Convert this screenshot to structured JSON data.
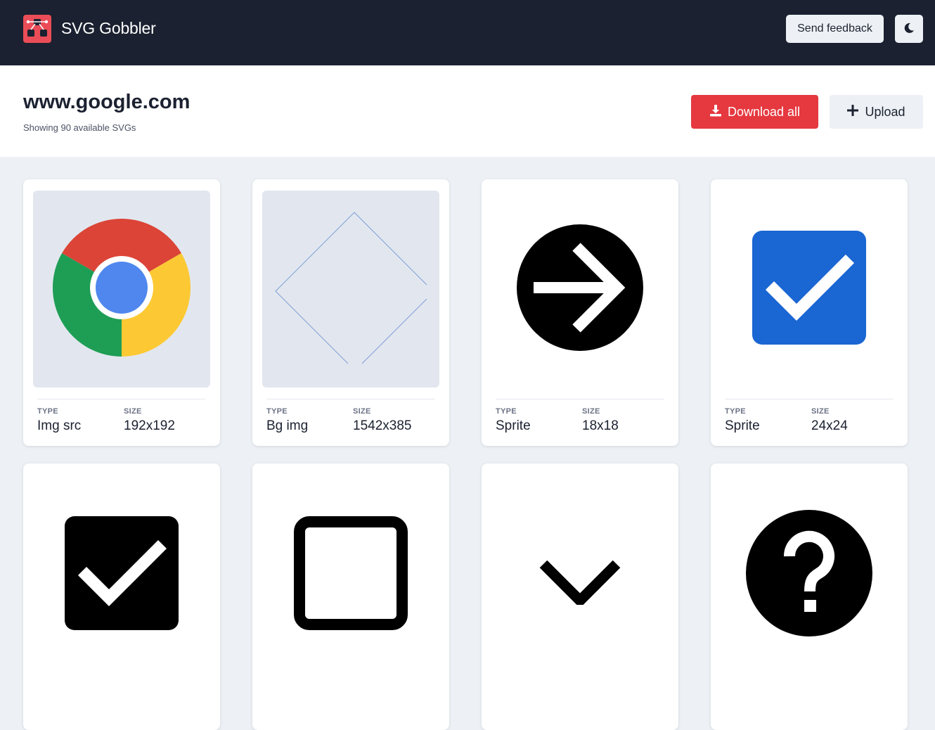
{
  "app": {
    "title": "SVG Gobbler",
    "feedback_label": "Send feedback",
    "theme_icon": "moon-icon",
    "logo_icon": "svg-gobbler-logo-icon"
  },
  "header": {
    "domain": "www.google.com",
    "subtitle": "Showing 90 available SVGs",
    "download_label": "Download all",
    "upload_label": "Upload"
  },
  "colors": {
    "topbar": "#1b2130",
    "accent": "#e5383f",
    "logo": "#ea4d57",
    "page_bg": "#edf1f5"
  },
  "meta_labels": {
    "type": "TYPE",
    "size": "SIZE"
  },
  "cards": [
    {
      "icon": "chrome-logo-icon",
      "type": "Img src",
      "size": "192x192"
    },
    {
      "icon": "diamond-outline-icon",
      "type": "Bg img",
      "size": "1542x385"
    },
    {
      "icon": "arrow-circle-right-icon",
      "type": "Sprite",
      "size": "18x18"
    },
    {
      "icon": "blue-checkbox-icon",
      "type": "Sprite",
      "size": "24x24"
    },
    {
      "icon": "black-checkbox-icon"
    },
    {
      "icon": "square-outline-icon"
    },
    {
      "icon": "chevron-down-icon"
    },
    {
      "icon": "help-circle-icon"
    }
  ]
}
